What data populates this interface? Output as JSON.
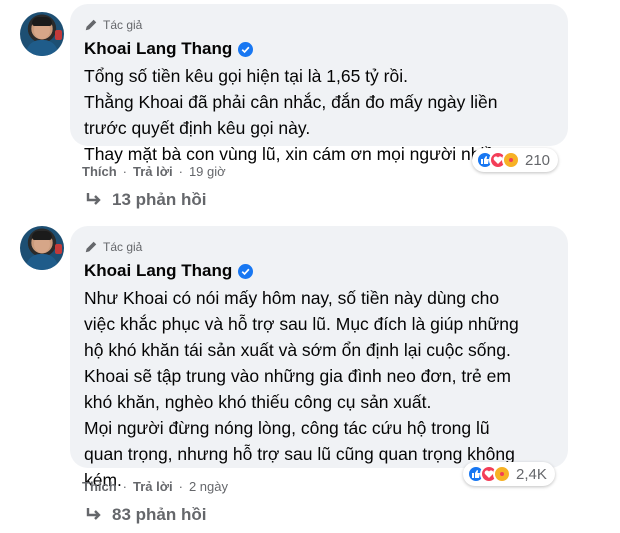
{
  "comments": [
    {
      "author_tag": "Tác giả",
      "author_name": "Khoai Lang Thang",
      "lines": [
        "Tổng số tiền kêu gọi hiện tại là 1,65 tỷ rồi.",
        "Thằng Khoai đã phải cân nhắc, đắn đo mấy ngày liền",
        "trước quyết định kêu gọi này.",
        "Thay mặt bà con vùng lũ, xin cám ơn mọi người nhiều!"
      ],
      "reaction_count": "210",
      "reactions": [
        "like-icon",
        "love-icon",
        "care-icon"
      ],
      "like_label": "Thích",
      "reply_label": "Trả lời",
      "time": "19 giờ",
      "replies_label": "13 phản hồi"
    },
    {
      "author_tag": "Tác giả",
      "author_name": "Khoai Lang Thang",
      "lines": [
        "Như Khoai có nói mấy hôm nay, số tiền này dùng cho",
        "việc khắc phục và hỗ trợ sau lũ. Mục đích là giúp những",
        "hộ khó khăn tái sản xuất và sớm ổn định lại cuộc sống.",
        "Khoai sẽ tập trung vào những gia đình neo đơn, trẻ em",
        "khó khăn, nghèo khó thiếu công cụ sản xuất.",
        "Mọi người đừng nóng lòng, công tác cứu hộ trong lũ",
        "quan trọng, nhưng hỗ trợ sau lũ cũng quan trọng không",
        "kém."
      ],
      "reaction_count": "2,4K",
      "reactions": [
        "like-icon",
        "love-icon",
        "care-icon"
      ],
      "like_label": "Thích",
      "reply_label": "Trả lời",
      "time": "2 ngày",
      "replies_label": "83 phản hồi"
    }
  ],
  "colors": {
    "bubble": "#f0f2f5",
    "verified": "#1877f2",
    "secondary_text": "#65676b"
  }
}
